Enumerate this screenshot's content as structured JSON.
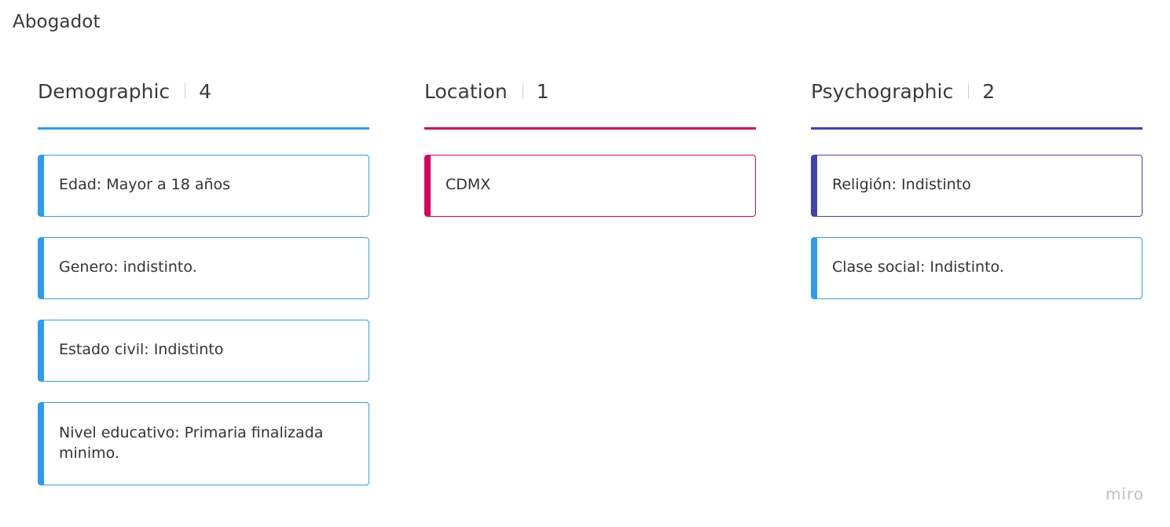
{
  "board": {
    "title": "Abogadot"
  },
  "columns": [
    {
      "title": "Demographic",
      "count": "4",
      "color": "#2d9bf0",
      "cards": [
        "Edad: Mayor a 18 años",
        "Genero: indistinto.",
        "Estado civil: Indistinto",
        "Nivel educativo: Primaria finalizada minimo."
      ]
    },
    {
      "title": "Location",
      "count": "1",
      "color": "#d6005f",
      "cards": [
        "CDMX"
      ]
    },
    {
      "title": "Psychographic",
      "count": "2",
      "color": "#3f43b3",
      "cards": [
        "Religión: Indistinto",
        "Clase social: Indistinto."
      ]
    }
  ],
  "card_colors": {
    "psychographic_1": "#3f43b3",
    "psychographic_2": "#2d9bf0"
  },
  "watermark": "miro"
}
